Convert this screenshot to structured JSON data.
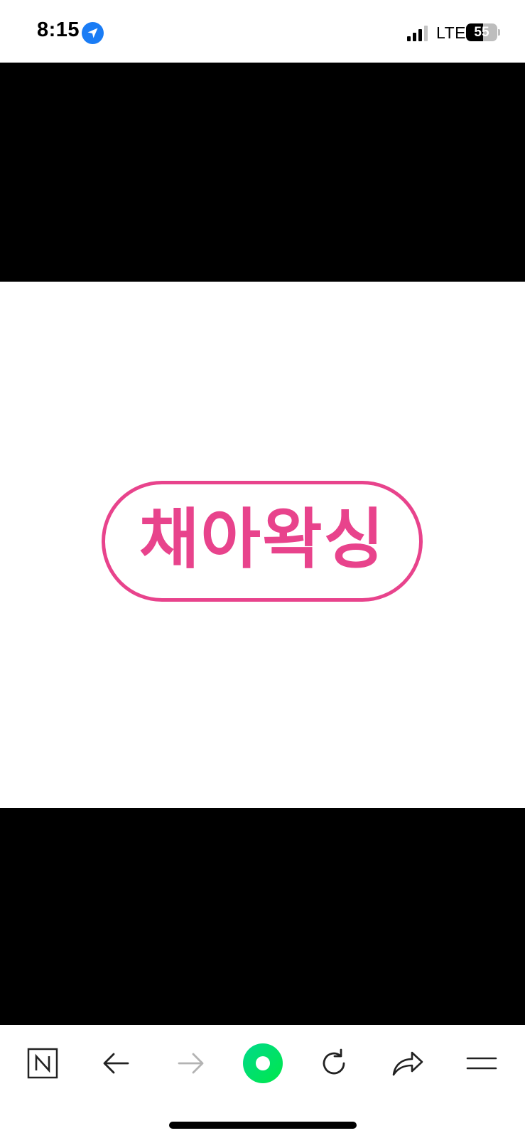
{
  "status_bar": {
    "time": "8:15",
    "network": "LTE",
    "battery_level": "55",
    "battery_fraction": 0.55
  },
  "content": {
    "logo_text": "채아왁싱",
    "logo_color": "#e8438c",
    "background_color": "#000000"
  },
  "toolbar": {
    "buttons": [
      {
        "name": "naver-home-button",
        "icon": "n-logo-icon"
      },
      {
        "name": "back-button",
        "icon": "arrow-left-icon"
      },
      {
        "name": "forward-button",
        "icon": "arrow-right-icon",
        "enabled": false
      },
      {
        "name": "green-dot-button",
        "icon": "green-dot-icon",
        "color": "#00de5a"
      },
      {
        "name": "reload-button",
        "icon": "reload-icon"
      },
      {
        "name": "share-button",
        "icon": "share-arrow-icon"
      },
      {
        "name": "menu-button",
        "icon": "menu-icon"
      }
    ]
  }
}
